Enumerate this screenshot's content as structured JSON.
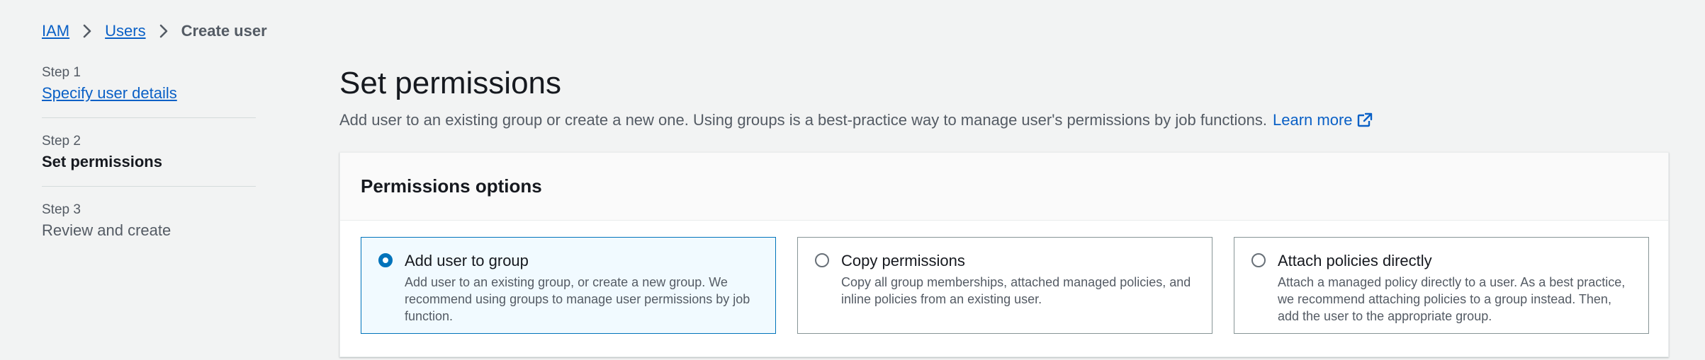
{
  "breadcrumb": {
    "items": [
      "IAM",
      "Users"
    ],
    "current": "Create user"
  },
  "steps": [
    {
      "num": "Step 1",
      "label": "Specify user details"
    },
    {
      "num": "Step 2",
      "label": "Set permissions"
    },
    {
      "num": "Step 3",
      "label": "Review and create"
    }
  ],
  "main": {
    "title": "Set permissions",
    "description": "Add user to an existing group or create a new one. Using groups is a best-practice way to manage user's permissions by job functions.",
    "learn_more": "Learn more"
  },
  "permissions": {
    "title": "Permissions options",
    "selected": "add_user_to_group",
    "options": [
      {
        "id": "add_user_to_group",
        "title": "Add user to group",
        "desc": "Add user to an existing group, or create a new group. We recommend using groups to manage user permissions by job function."
      },
      {
        "id": "copy_permissions",
        "title": "Copy permissions",
        "desc": "Copy all group memberships, attached managed policies, and inline policies from an existing user."
      },
      {
        "id": "attach_policies_directly",
        "title": "Attach policies directly",
        "desc": "Attach a managed policy directly to a user. As a best practice, we recommend attaching policies to a group instead. Then, add the user to the appropriate group."
      }
    ]
  },
  "colors": {
    "link": "#0a60c6",
    "accent": "#0073bb",
    "selected_bg": "#f1faff"
  }
}
